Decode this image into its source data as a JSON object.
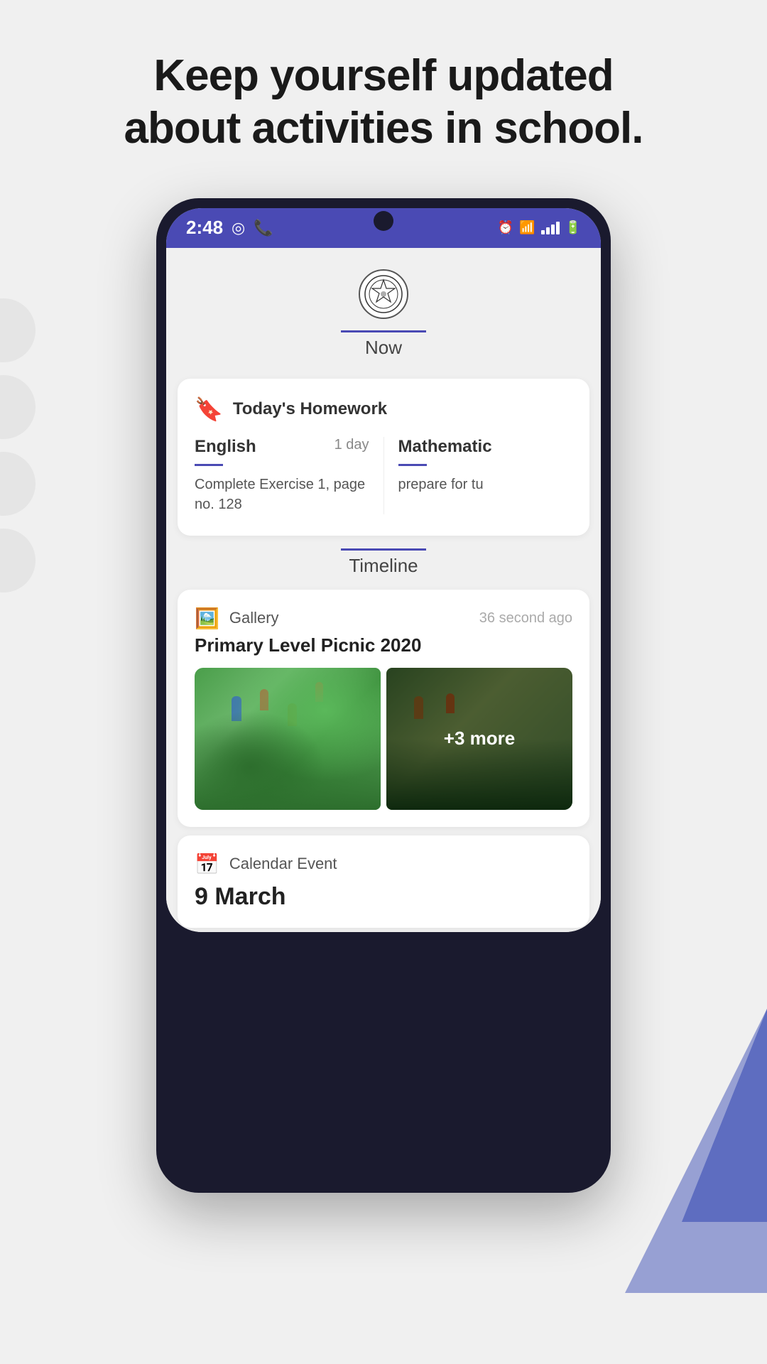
{
  "header": {
    "title_line1": "Keep yourself updated",
    "title_line2": "about activities in school."
  },
  "status_bar": {
    "time": "2:48",
    "icons_right": [
      "alarm",
      "wifi",
      "signal",
      "battery"
    ]
  },
  "school_logo": {
    "alt": "School Logo"
  },
  "now_tab": {
    "label": "Now"
  },
  "homework_card": {
    "icon": "📚",
    "title": "Today's Homework",
    "items": [
      {
        "subject": "English",
        "due": "1 day",
        "task": "Complete Exercise 1, page no. 128"
      },
      {
        "subject": "Mathematic",
        "due": "",
        "task": "prepare for tu"
      }
    ]
  },
  "timeline_tab": {
    "label": "Timeline"
  },
  "gallery_post": {
    "type": "Gallery",
    "time": "36 second ago",
    "title": "Primary Level Picnic 2020",
    "more_count": "+3 more"
  },
  "calendar_event": {
    "type": "Calendar Event",
    "date": "9 March"
  }
}
